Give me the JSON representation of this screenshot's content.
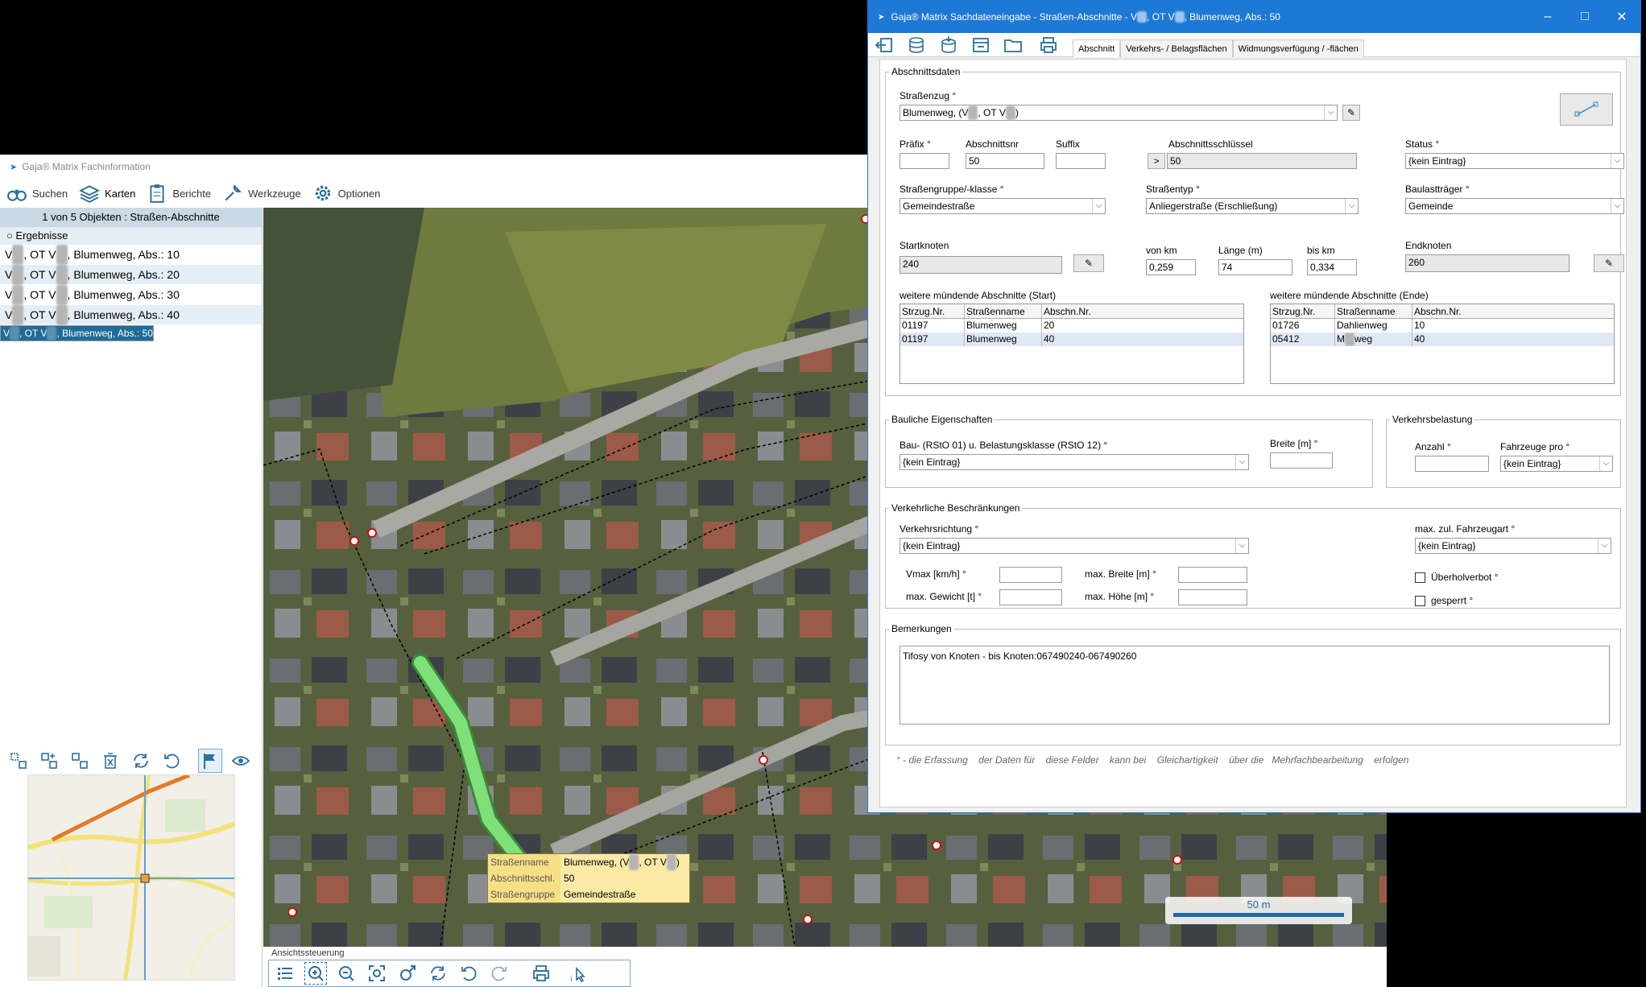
{
  "main_window": {
    "title": "Gaja® Matrix Fachinformation",
    "toolbar": {
      "search": "Suchen",
      "maps": "Karten",
      "reports": "Berichte",
      "tools": "Werkzeuge",
      "options": "Optionen"
    },
    "results": {
      "header": "1 von 5 Objekten : Straßen-Abschnitte",
      "label": "Ergebnisse",
      "items": [
        {
          "pre": "V",
          "mid": ", OT V",
          "post": ", Blumenweg, Abs.: 10"
        },
        {
          "pre": "V",
          "mid": ", OT V",
          "post": ", Blumenweg, Abs.: 20"
        },
        {
          "pre": "V",
          "mid": ", OT V",
          "post": ", Blumenweg, Abs.: 30"
        },
        {
          "pre": "V",
          "mid": ", OT V",
          "post": ", Blumenweg, Abs.: 40"
        },
        {
          "pre": "V",
          "mid": ", OT V",
          "post": ", Blumenweg, Abs.: 50"
        }
      ],
      "selected_index": 4
    },
    "map": {
      "scale_label": "50 m",
      "tooltip": {
        "rows": [
          {
            "key": "Straßenname",
            "value": "Blumenweg, (V",
            "value_suffix": ", OT V",
            "value_end": ")"
          },
          {
            "key": "Abschnittsschl.",
            "value": "50"
          },
          {
            "key": "Straßengruppe",
            "value": "Gemeindestraße"
          }
        ]
      }
    },
    "view_control_label": "Ansichtssteuerung"
  },
  "dialog": {
    "title_prefix": "Gaja® Matrix Sachdateneingabe - Straßen-Abschnitte - V",
    "title_mid": ", OT V",
    "title_suffix": ", Blumenweg, Abs.: 50",
    "tabs": [
      "Abschnitt",
      "Verkehrs- / Belagsflächen",
      "Widmungsverfügung / -flächen"
    ],
    "sections": {
      "abschnittsdaten": "Abschnittsdaten",
      "bauliche": "Bauliche Eigenschaften",
      "verkehrsbelastung": "Verkehrsbelastung",
      "beschraenkungen": "Verkehrliche Beschränkungen",
      "bemerkungen": "Bemerkungen"
    },
    "fields": {
      "strassenzug_label": "Straßenzug °",
      "strassenzug_value_a": "Blumenweg, (V",
      "strassenzug_value_b": ", OT V",
      "strassenzug_value_c": ")",
      "praefix_label": "Präfix °",
      "praefix_value": "",
      "abschnittsnr_label": "Abschnittsnr",
      "abschnittsnr_value": "50",
      "suffix_label": "Suffix",
      "suffix_value": "",
      "schluessel_label": "Abschnittsschlüssel",
      "schluessel_button": ">",
      "schluessel_value": "50",
      "status_label": "Status °",
      "status_value": "{kein Eintrag}",
      "gruppe_label": "Straßengruppe/-klasse °",
      "gruppe_value": "Gemeindestraße",
      "typ_label": "Straßentyp °",
      "typ_value": "Anliegerstraße (Erschließung)",
      "traeger_label": "Baulastträger °",
      "traeger_value": "Gemeinde",
      "startknoten_label": "Startknoten",
      "startknoten_value": "240",
      "vonkm_label": "von km",
      "vonkm_value": "0,259",
      "laenge_label": "Länge (m)",
      "laenge_value": "74",
      "biskm_label": "bis km",
      "biskm_value": "0,334",
      "endknoten_label": "Endknoten",
      "endknoten_value": "260",
      "start_table_label": "weitere mündende Abschnitte (Start)",
      "end_table_label": "weitere mündende Abschnitte (Ende)",
      "bauklasse_label": "Bau- (RStO 01) u. Belastungsklasse (RStO 12) °",
      "bauklasse_value": "{kein Eintrag}",
      "breite_label": "Breite [m] °",
      "breite_value": "",
      "anzahl_label": "Anzahl °",
      "anzahl_value": "",
      "fahrzeuge_label": "Fahrzeuge pro °",
      "fahrzeuge_value": "{kein Eintrag}",
      "richtung_label": "Verkehrsrichtung °",
      "richtung_value": "{kein Eintrag}",
      "fahrzeugart_label": "max. zul. Fahrzeugart °",
      "fahrzeugart_value": "{kein Eintrag}",
      "vmax_label": "Vmax [km/h] °",
      "max_breite_label": "max. Breite [m] °",
      "max_gewicht_label": "max. Gewicht [t] °",
      "max_hoehe_label": "max. Höhe [m] °",
      "ueberholverbot_label": "Überholverbot °",
      "gesperrt_label": "gesperrt °",
      "bemerkungen_value": "Tifosy von Knoten - bis Knoten:067490240-067490260"
    },
    "start_table": {
      "columns": [
        "Strzug.Nr.",
        "Straßenname",
        "Abschn.Nr."
      ],
      "rows": [
        [
          "01197",
          "Blumenweg",
          "20"
        ],
        [
          "01197",
          "Blumenweg",
          "40"
        ]
      ]
    },
    "end_table": {
      "columns": [
        "Strzug.Nr.",
        "Straßenname",
        "Abschn.Nr."
      ],
      "rows": [
        [
          "01726",
          "Dahlienweg",
          "10"
        ],
        [
          "05412",
          "M",
          "40"
        ]
      ],
      "row2_name_suffix": "weg"
    },
    "footnote": "° - die Erfassung    der Daten für    diese Felder    kann bei    Gleichartigkeit    über die   Mehrfachbearbeitung    erfolgen"
  }
}
